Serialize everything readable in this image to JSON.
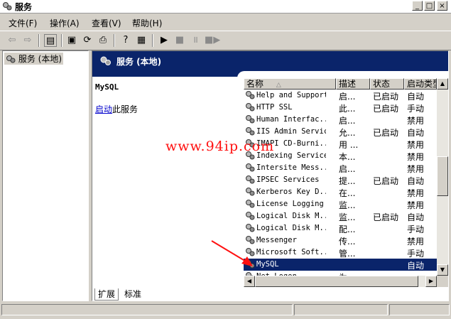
{
  "window": {
    "title": "服务",
    "controls": [
      "_",
      "□",
      "×"
    ]
  },
  "menu": [
    "文件(F)",
    "操作(A)",
    "查看(V)",
    "帮助(H)"
  ],
  "toolbar": {
    "icons": [
      "back-icon",
      "forward-icon",
      "show-tree-icon",
      "properties-icon",
      "refresh-icon",
      "export-icon",
      "help-icon",
      "console-icon",
      "start-icon",
      "stop-icon",
      "pause-icon",
      "restart-icon"
    ]
  },
  "tree": {
    "root_label": "服务 (本地)"
  },
  "panel": {
    "header_title": "服务 (本地)",
    "selected_service": "MySQL",
    "start_link": "启动",
    "start_suffix": "此服务"
  },
  "columns": [
    "名称",
    "描述",
    "状态",
    "启动类型"
  ],
  "sort_arrow": "△",
  "services": [
    {
      "name": "Help and Support",
      "desc": "启...",
      "status": "已启动",
      "startup": "自动"
    },
    {
      "name": "HTTP SSL",
      "desc": "此...",
      "status": "已启动",
      "startup": "手动"
    },
    {
      "name": "Human Interfac...",
      "desc": "启...",
      "status": "",
      "startup": "禁用"
    },
    {
      "name": "IIS Admin Service",
      "desc": "允...",
      "status": "已启动",
      "startup": "自动"
    },
    {
      "name": "IMAPI CD-Burni...",
      "desc": "用 ...",
      "status": "",
      "startup": "禁用"
    },
    {
      "name": "Indexing Service",
      "desc": "本...",
      "status": "",
      "startup": "禁用"
    },
    {
      "name": "Intersite Mess...",
      "desc": "启...",
      "status": "",
      "startup": "禁用"
    },
    {
      "name": "IPSEC Services",
      "desc": "提...",
      "status": "已启动",
      "startup": "自动"
    },
    {
      "name": "Kerberos Key D...",
      "desc": "在...",
      "status": "",
      "startup": "禁用"
    },
    {
      "name": "License Logging",
      "desc": "监...",
      "status": "",
      "startup": "禁用"
    },
    {
      "name": "Logical Disk M...",
      "desc": "监...",
      "status": "已启动",
      "startup": "自动"
    },
    {
      "name": "Logical Disk M...",
      "desc": "配...",
      "status": "",
      "startup": "手动"
    },
    {
      "name": "Messenger",
      "desc": "传...",
      "status": "",
      "startup": "禁用"
    },
    {
      "name": "Microsoft Soft...",
      "desc": "管...",
      "status": "",
      "startup": "手动"
    },
    {
      "name": "MySQL",
      "desc": "",
      "status": "",
      "startup": "自动"
    },
    {
      "name": "Net Logon",
      "desc": "为...",
      "status": "",
      "startup": ""
    }
  ],
  "selected_index": 14,
  "tabs": [
    "扩展",
    "标准"
  ],
  "watermark": "www.94ip.com",
  "colors": {
    "header": "#0a246a",
    "selection": "#0a246a",
    "link": "#0000cc",
    "watermark": "#ff1010"
  }
}
